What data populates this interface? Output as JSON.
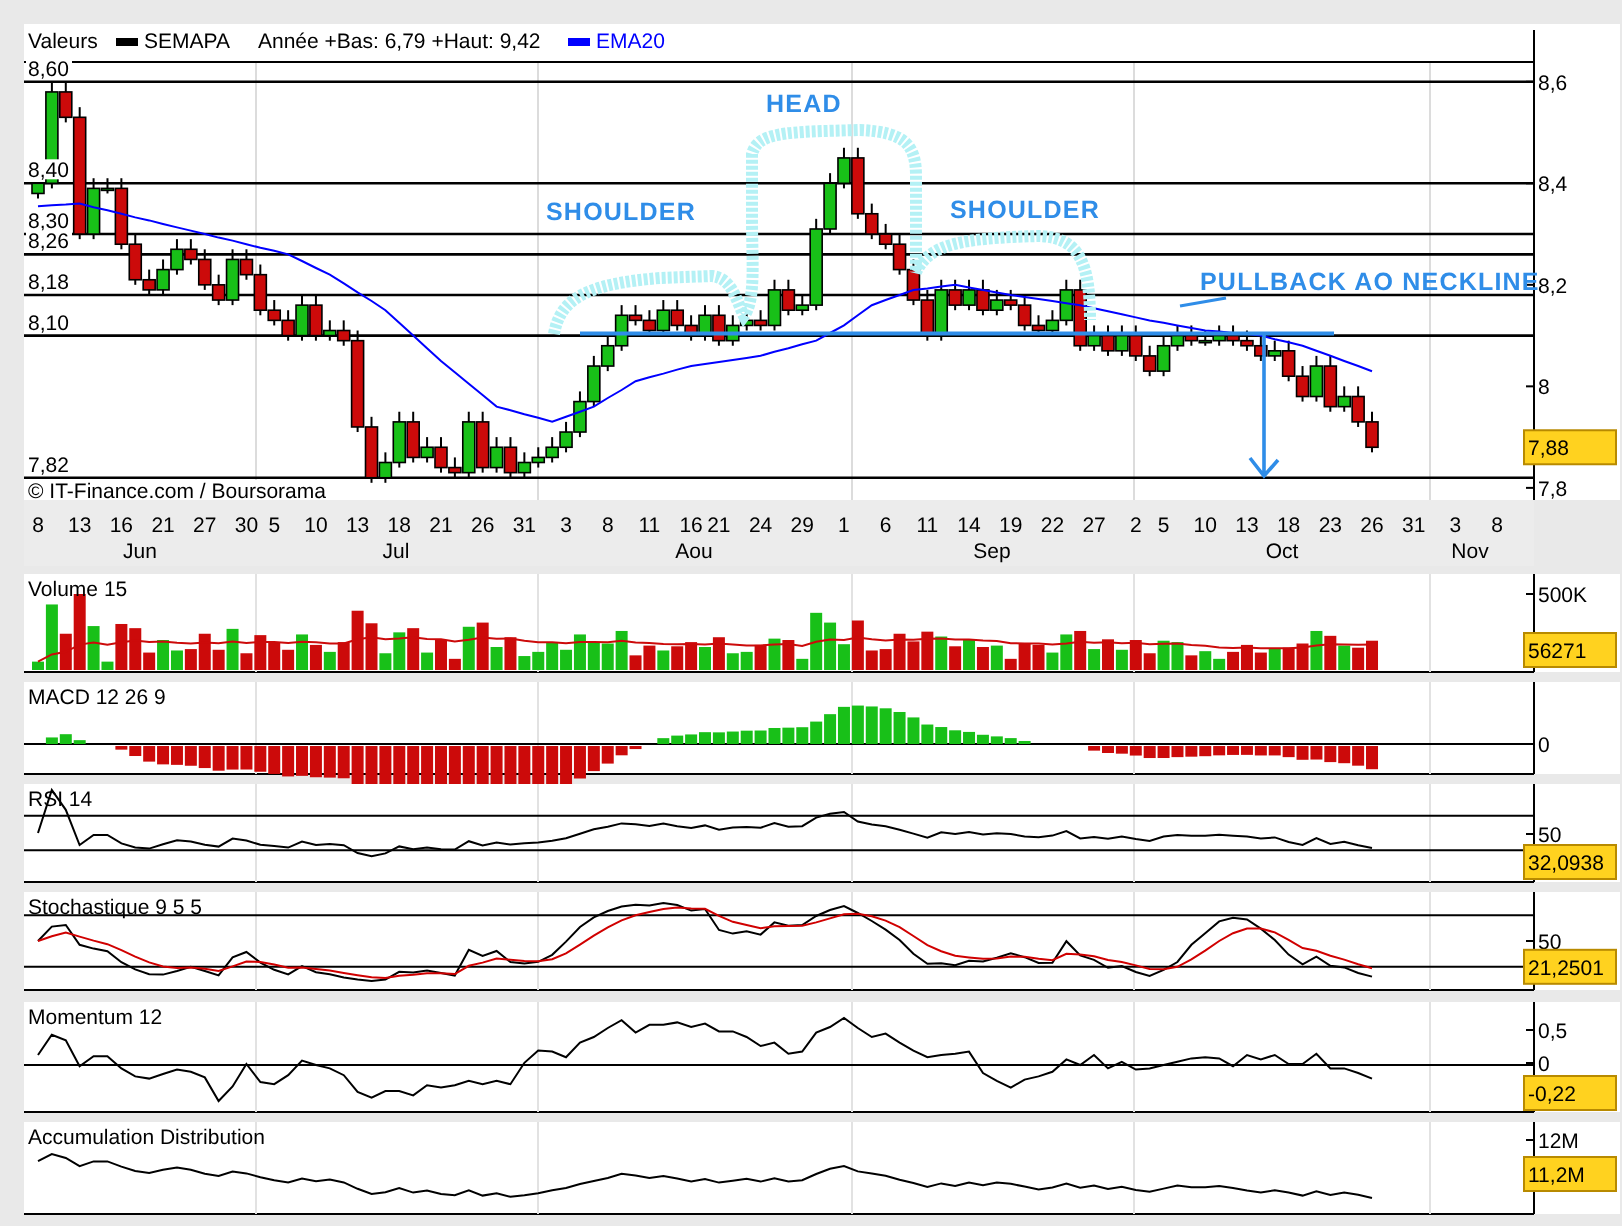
{
  "price_panel": {
    "header": {
      "title": "Valeurs",
      "range_text": "Année +Bas: 6,79 +Haut: 9,42"
    },
    "legend": [
      {
        "label": "SEMAPA",
        "color": "#000000"
      }
    ],
    "level_lines": [
      "8,60",
      "8,40",
      "8,30",
      "8,26",
      "8,18",
      "8,10",
      "7,82"
    ],
    "credit": "© IT-Finance.com / Boursorama",
    "annotations": [
      "HEAD",
      "SHOULDER",
      "SHOULDER",
      "PULLBACK AO NECKLINE"
    ],
    "current_value": "7,88",
    "month_labels": [
      "Jun",
      "Jul",
      "Aou",
      "Sep",
      "Oct",
      "Nov"
    ],
    "chart_data": {
      "type": "candlestick",
      "grid": true,
      "ylim": [
        7.784,
        8.702
      ],
      "yticks": [
        {
          "value": 8.6,
          "label": "8,6"
        },
        {
          "value": 8.4,
          "label": "8,4"
        },
        {
          "value": 8.2,
          "label": "8,2"
        },
        {
          "value": 8,
          "label": "8"
        },
        {
          "value": 7.8,
          "label": "7,8"
        }
      ],
      "categories": [
        "8",
        null,
        null,
        "13",
        null,
        null,
        "16",
        null,
        null,
        "21",
        null,
        null,
        "27",
        null,
        null,
        "30",
        null,
        "5",
        null,
        null,
        "10",
        null,
        null,
        "13",
        null,
        null,
        "18",
        null,
        null,
        "21",
        null,
        null,
        "26",
        null,
        null,
        "31",
        null,
        null,
        "3",
        null,
        null,
        "8",
        null,
        null,
        "11",
        null,
        null,
        "16",
        null,
        "21",
        null,
        null,
        "24",
        null,
        null,
        "29",
        null,
        null,
        "1",
        null,
        null,
        "6",
        null,
        null,
        "11",
        null,
        null,
        "14",
        null,
        null,
        "19",
        null,
        null,
        "22",
        null,
        null,
        "27",
        null,
        null,
        "2",
        null,
        "5",
        null,
        null,
        "10",
        null,
        null,
        "13",
        null,
        null,
        "18",
        null,
        null,
        "23",
        null,
        null,
        "26",
        null,
        null,
        "31",
        null,
        null,
        "3",
        null,
        null,
        "8"
      ],
      "ohlc": [
        [
          8.38,
          8.4,
          8.37,
          8.4
        ],
        [
          8.4,
          8.6,
          8.39,
          8.58
        ],
        [
          8.58,
          8.6,
          8.52,
          8.53
        ],
        [
          8.53,
          8.55,
          8.29,
          8.3
        ],
        [
          8.3,
          8.41,
          8.29,
          8.39
        ],
        [
          8.39,
          8.41,
          8.38,
          8.39
        ],
        [
          8.39,
          8.41,
          8.27,
          8.28
        ],
        [
          8.28,
          8.3,
          8.2,
          8.21
        ],
        [
          8.21,
          8.23,
          8.18,
          8.19
        ],
        [
          8.19,
          8.25,
          8.18,
          8.23
        ],
        [
          8.23,
          8.29,
          8.22,
          8.27
        ],
        [
          8.27,
          8.29,
          8.24,
          8.25
        ],
        [
          8.25,
          8.27,
          8.19,
          8.2
        ],
        [
          8.2,
          8.22,
          8.16,
          8.17
        ],
        [
          8.17,
          8.27,
          8.16,
          8.25
        ],
        [
          8.25,
          8.27,
          8.21,
          8.22
        ],
        [
          8.22,
          8.24,
          8.14,
          8.15
        ],
        [
          8.15,
          8.17,
          8.12,
          8.13
        ],
        [
          8.13,
          8.15,
          8.09,
          8.1
        ],
        [
          8.1,
          8.18,
          8.09,
          8.16
        ],
        [
          8.16,
          8.18,
          8.09,
          8.1
        ],
        [
          8.1,
          8.13,
          8.09,
          8.11
        ],
        [
          8.11,
          8.13,
          8.08,
          8.09
        ],
        [
          8.09,
          8.11,
          7.91,
          7.92
        ],
        [
          7.92,
          7.94,
          7.81,
          7.82
        ],
        [
          7.82,
          7.87,
          7.81,
          7.85
        ],
        [
          7.85,
          7.95,
          7.84,
          7.93
        ],
        [
          7.93,
          7.95,
          7.85,
          7.86
        ],
        [
          7.86,
          7.9,
          7.85,
          7.88
        ],
        [
          7.88,
          7.9,
          7.83,
          7.84
        ],
        [
          7.84,
          7.86,
          7.82,
          7.83
        ],
        [
          7.83,
          7.95,
          7.82,
          7.93
        ],
        [
          7.93,
          7.95,
          7.83,
          7.84
        ],
        [
          7.84,
          7.9,
          7.83,
          7.88
        ],
        [
          7.88,
          7.9,
          7.82,
          7.83
        ],
        [
          7.83,
          7.87,
          7.82,
          7.85
        ],
        [
          7.85,
          7.88,
          7.84,
          7.86
        ],
        [
          7.86,
          7.9,
          7.85,
          7.88
        ],
        [
          7.88,
          7.93,
          7.87,
          7.91
        ],
        [
          7.91,
          7.99,
          7.9,
          7.97
        ],
        [
          7.97,
          8.06,
          7.96,
          8.04
        ],
        [
          8.04,
          8.1,
          8.03,
          8.08
        ],
        [
          8.08,
          8.16,
          8.07,
          8.14
        ],
        [
          8.14,
          8.16,
          8.12,
          8.13
        ],
        [
          8.13,
          8.15,
          8.1,
          8.11
        ],
        [
          8.11,
          8.17,
          8.1,
          8.15
        ],
        [
          8.15,
          8.17,
          8.11,
          8.12
        ],
        [
          8.12,
          8.14,
          8.09,
          8.1
        ],
        [
          8.1,
          8.16,
          8.09,
          8.14
        ],
        [
          8.14,
          8.16,
          8.08,
          8.09
        ],
        [
          8.09,
          8.14,
          8.08,
          8.12
        ],
        [
          8.12,
          8.15,
          8.11,
          8.13
        ],
        [
          8.13,
          8.15,
          8.11,
          8.12
        ],
        [
          8.12,
          8.21,
          8.11,
          8.19
        ],
        [
          8.19,
          8.21,
          8.14,
          8.15
        ],
        [
          8.15,
          8.18,
          8.14,
          8.16
        ],
        [
          8.16,
          8.33,
          8.15,
          8.31
        ],
        [
          8.31,
          8.42,
          8.3,
          8.4
        ],
        [
          8.4,
          8.47,
          8.39,
          8.45
        ],
        [
          8.45,
          8.47,
          8.33,
          8.34
        ],
        [
          8.34,
          8.36,
          8.29,
          8.3
        ],
        [
          8.3,
          8.32,
          8.27,
          8.28
        ],
        [
          8.28,
          8.3,
          8.22,
          8.23
        ],
        [
          8.23,
          8.25,
          8.16,
          8.17
        ],
        [
          8.17,
          8.19,
          8.09,
          8.1
        ],
        [
          8.1,
          8.21,
          8.09,
          8.19
        ],
        [
          8.19,
          8.21,
          8.15,
          8.16
        ],
        [
          8.16,
          8.21,
          8.15,
          8.19
        ],
        [
          8.19,
          8.21,
          8.14,
          8.15
        ],
        [
          8.15,
          8.19,
          8.14,
          8.17
        ],
        [
          8.17,
          8.19,
          8.15,
          8.16
        ],
        [
          8.16,
          8.18,
          8.11,
          8.12
        ],
        [
          8.12,
          8.14,
          8.1,
          8.11
        ],
        [
          8.11,
          8.15,
          8.1,
          8.13
        ],
        [
          8.13,
          8.21,
          8.12,
          8.19
        ],
        [
          8.19,
          8.21,
          8.07,
          8.08
        ],
        [
          8.08,
          8.12,
          8.07,
          8.1
        ],
        [
          8.1,
          8.12,
          8.06,
          8.07
        ],
        [
          8.07,
          8.12,
          8.06,
          8.1
        ],
        [
          8.1,
          8.12,
          8.05,
          8.06
        ],
        [
          8.06,
          8.08,
          8.02,
          8.03
        ],
        [
          8.03,
          8.1,
          8.02,
          8.08
        ],
        [
          8.08,
          8.12,
          8.07,
          8.1
        ],
        [
          8.1,
          8.12,
          8.08,
          8.09
        ],
        [
          8.09,
          8.11,
          8.08,
          8.09
        ],
        [
          8.09,
          8.12,
          8.08,
          8.1
        ],
        [
          8.1,
          8.12,
          8.08,
          8.09
        ],
        [
          8.09,
          8.11,
          8.07,
          8.08
        ],
        [
          8.08,
          8.1,
          8.05,
          8.06
        ],
        [
          8.06,
          8.09,
          8.05,
          8.07
        ],
        [
          8.07,
          8.09,
          8.01,
          8.02
        ],
        [
          8.02,
          8.04,
          7.97,
          7.98
        ],
        [
          7.98,
          8.06,
          7.97,
          8.04
        ],
        [
          8.04,
          8.06,
          7.95,
          7.96
        ],
        [
          7.96,
          8.0,
          7.95,
          7.98
        ],
        [
          7.98,
          8.0,
          7.92,
          7.93
        ],
        [
          7.93,
          7.95,
          7.87,
          7.88
        ],
        null,
        null,
        null,
        null,
        null,
        null,
        null,
        null,
        null
      ],
      "series": [
        {
          "name": "EMA20",
          "type": "line",
          "color": "#0000ff",
          "values": [
            8.355,
            8.357,
            8.358,
            8.36,
            8.353,
            8.347,
            8.34,
            8.333,
            8.327,
            8.32,
            8.313,
            8.307,
            8.3,
            8.293,
            8.287,
            8.28,
            8.273,
            8.267,
            8.26,
            8.247,
            8.233,
            8.22,
            8.203,
            8.185,
            8.168,
            8.15,
            8.125,
            8.1,
            8.075,
            8.05,
            8.028,
            8.005,
            7.983,
            7.96,
            7.953,
            7.945,
            7.938,
            7.93,
            7.94,
            7.95,
            7.96,
            7.977,
            7.993,
            8.01,
            8.018,
            8.025,
            8.033,
            8.04,
            8.044,
            8.048,
            8.052,
            8.056,
            8.06,
            8.068,
            8.075,
            8.083,
            8.09,
            8.105,
            8.12,
            8.14,
            8.16,
            8.17,
            8.18,
            8.19,
            8.193,
            8.197,
            8.2,
            8.195,
            8.19,
            8.185,
            8.18,
            8.176,
            8.172,
            8.168,
            8.164,
            8.16,
            8.154,
            8.148,
            8.142,
            8.136,
            8.13,
            8.125,
            8.12,
            8.115,
            8.11,
            8.108,
            8.105,
            8.103,
            8.1,
            8.093,
            8.087,
            8.08,
            8.07,
            8.06,
            8.05,
            8.04,
            8.03,
            null,
            null,
            null,
            null,
            null,
            null,
            null,
            null,
            null
          ]
        }
      ]
    }
  },
  "indicator_panels": [
    {
      "kind": "volume",
      "title": "Volume 15",
      "axis_labels": [
        "500K"
      ],
      "current_value": "56271"
    },
    {
      "kind": "macd",
      "title": "MACD 12 26 9",
      "axis_labels": [
        "0"
      ]
    },
    {
      "kind": "rsi",
      "title": "RSI 14",
      "axis_labels": [
        "50"
      ],
      "current_value": "32,0938"
    },
    {
      "kind": "stochastic",
      "title": "Stochastique 9 5 5",
      "axis_labels": [
        "50"
      ],
      "current_value": "21,2501"
    },
    {
      "kind": "momentum",
      "title": "Momentum 12",
      "axis_labels": [
        "0,5",
        "0"
      ],
      "current_value": "-0,22"
    },
    {
      "kind": "accumulation",
      "title": "Accumulation Distribution",
      "axis_labels": [
        "12M"
      ],
      "current_value": "11,2M"
    }
  ]
}
